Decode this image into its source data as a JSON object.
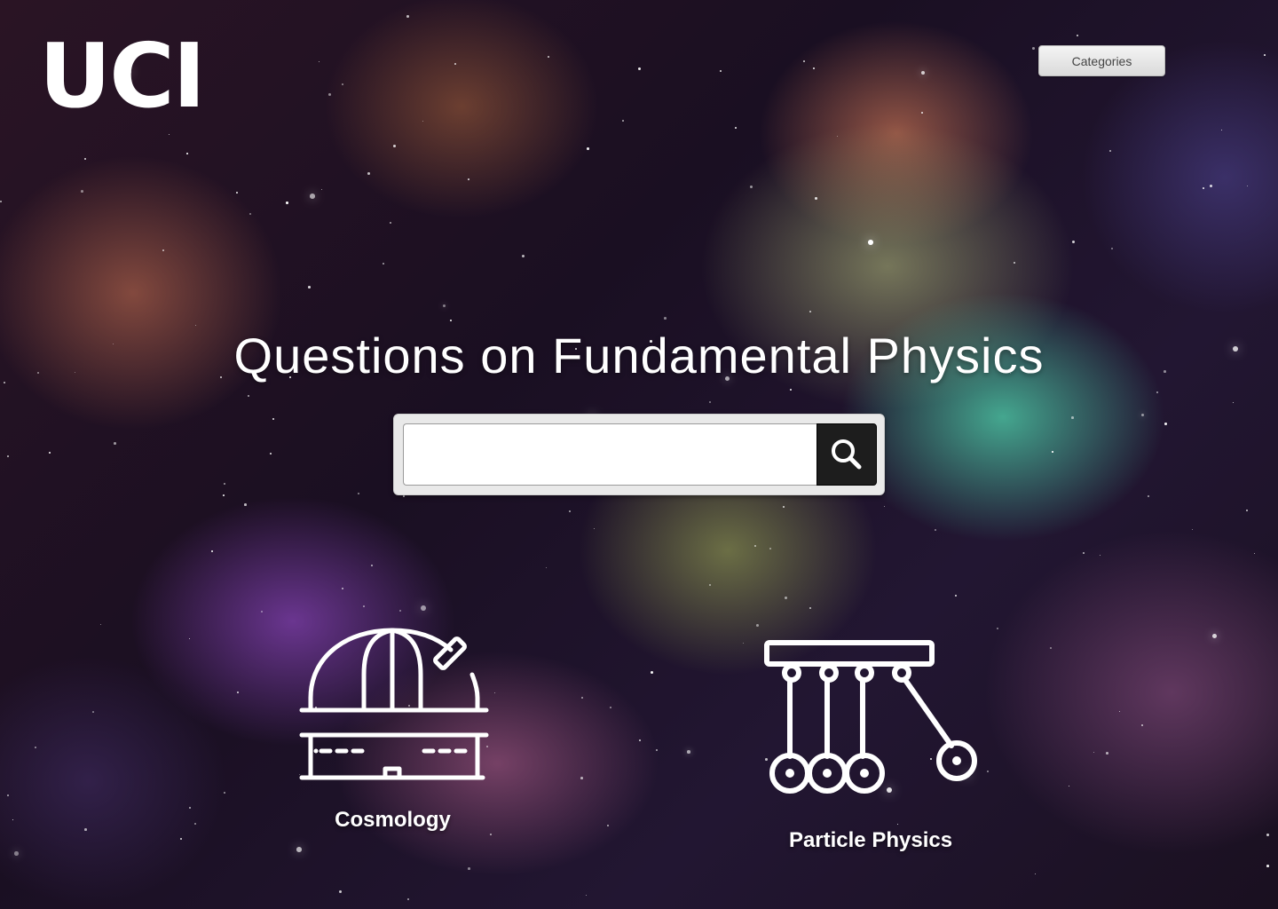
{
  "header": {
    "logo_text": "UCI",
    "categories_label": "Categories"
  },
  "hero": {
    "title": "Questions on Fundamental Physics"
  },
  "search": {
    "value": "",
    "placeholder": "",
    "button_icon": "search-icon"
  },
  "categories": [
    {
      "label": "Cosmology",
      "icon": "observatory-icon"
    },
    {
      "label": "Particle Physics",
      "icon": "newtons-cradle-icon"
    }
  ],
  "colors": {
    "text": "#ffffff",
    "search_button": "#1d1d1d",
    "categories_button": "#e6e6e6"
  }
}
